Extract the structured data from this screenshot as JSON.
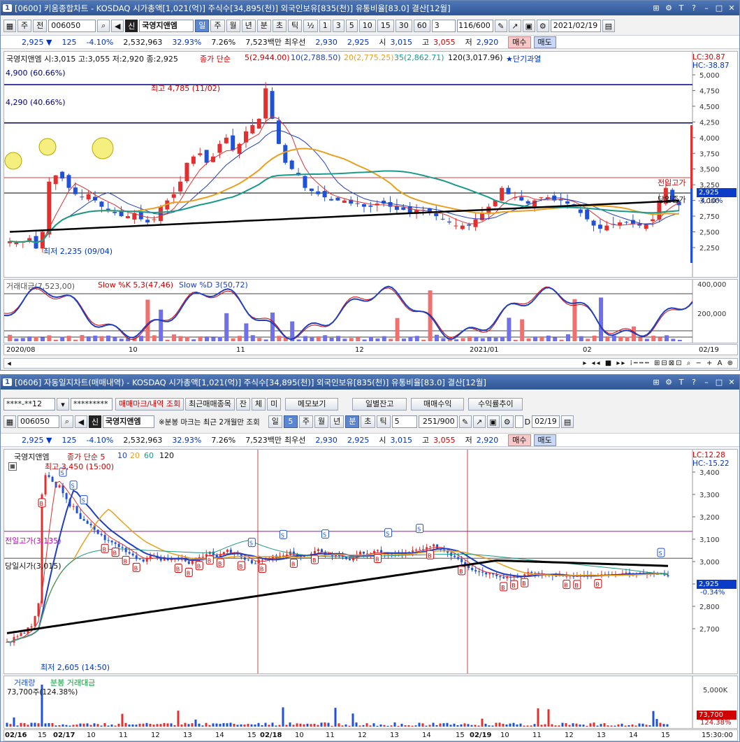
{
  "w1": {
    "title": "[0600] 키움종합차트 - KOSDAQ 시가총액[1,021(억)] 주식수[34,895(천)] 외국인보유[835(천)] 유통비율[83.0] 결산[12월]",
    "num": "1",
    "toolbar": {
      "mode": "주",
      "market": "전",
      "code": "006050",
      "stock": "국영지앤엠",
      "periods": [
        "일",
        "주",
        "월",
        "년",
        "분",
        "초",
        "틱"
      ],
      "half": "½",
      "nums": [
        "1",
        "3",
        "5",
        "10",
        "15",
        "30",
        "60"
      ],
      "sel": "3",
      "count": "116",
      "total": "/600",
      "date": "2021/02/19",
      "sin": "신"
    },
    "quote": {
      "price": "2,925 ▼",
      "chg": "125",
      "pct": "-4.10%",
      "vol": "2,532,963",
      "turn": "32.93%",
      "r2": "7.26%",
      "amt": "7,523백만",
      "bestlabel": "최우선",
      "b1": "2,930",
      "b2": "2,925",
      "open_l": "시",
      "open": "3,015",
      "high_l": "고",
      "high": "3,055",
      "low_l": "저",
      "low": "2,920",
      "buy": "매수",
      "sell": "매도"
    },
    "legend": {
      "ohlc": "국영지앤엠 시:3,015 고:3,055 저:2,920 종:2,925",
      "ma": "종가 단순",
      "ma5": "5(2,944.00)",
      "ma10": "10(2,788.50)",
      "ma20": "20(2,775.25)",
      "ma35": "35(2,862.71)",
      "ma120": "120(3,017.96)",
      "star": "★단기과열"
    },
    "lc": "LC:30.87",
    "hc": "HC:-38.87",
    "y": [
      "5,000",
      "4,750",
      "4,500",
      "4,250",
      "4,000",
      "3,750",
      "3,500",
      "3,250",
      "3,000",
      "2,750",
      "2,500",
      "2,250"
    ],
    "hl1": "4,900 (60.66%)",
    "hl2": "4,290 (40.66%)",
    "max": "최고 4,785 (11/02)",
    "min": "최저 2,235 (09/04)",
    "prevhi": "전일고가",
    "todayclose": "당일종가",
    "cur": "2,925",
    "curpct": "-4.10%",
    "sub": {
      "vol": "거래대금(7,523,00)",
      "k": "Slow %K 5,3(47,46)",
      "d": "Slow %D 3(50,72)",
      "y1": "400,000",
      "y2": "200,000"
    },
    "x": [
      "2020/08",
      "10",
      "11",
      "12",
      "2021/01",
      "02",
      "02/19"
    ]
  },
  "w2": {
    "title": "[0606] 자동일지차트(매매내역) - KOSDAQ 시가총액[1,021(억)] 주식수[34,895(천)] 외국인보유[835(천)] 유통비율[83.0] 결산[12월]",
    "num": "1",
    "acct": "****-**12",
    "pw": "*********",
    "btns": [
      "매매마크/내역 조회",
      "최근매매종목",
      "잔",
      "체",
      "미",
      "메모보기",
      "일별잔고",
      "매매수익",
      "수익률추이"
    ],
    "toolbar": {
      "code": "006050",
      "stock": "국영지앤엠",
      "note": "※분봉 마크는 최근 2개월만 조회",
      "periods": [
        "일",
        "주",
        "월",
        "년",
        "분",
        "초",
        "틱"
      ],
      "sel": "5",
      "count": "251",
      "total": "/900",
      "d": "D",
      "date": "02/19",
      "sin": "신"
    },
    "quote": {
      "price": "2,925 ▼",
      "chg": "125",
      "pct": "-4.10%",
      "vol": "2,532,963",
      "turn": "32.93%",
      "r2": "7.26%",
      "amt": "7,523백만",
      "bestlabel": "최우선",
      "b1": "2,930",
      "b2": "2,925",
      "open_l": "시",
      "open": "3,015",
      "high_l": "고",
      "high": "3,055",
      "low_l": "저",
      "low": "2,920",
      "buy": "매수",
      "sell": "매도"
    },
    "legend": {
      "stock": "국영지앤엠",
      "ma": "종가 단순 5",
      "m10": "10",
      "m20": "20",
      "m60": "60",
      "m120": "120"
    },
    "lc": "LC:12.28",
    "hc": "HC:-15.22",
    "y": [
      "3,400",
      "3,300",
      "3,200",
      "3,100",
      "3,000",
      "2,900",
      "2,800",
      "2,700"
    ],
    "max": "최고 3,450 (15:00)",
    "min": "최저 2,605 (14:50)",
    "prevhi": "전일고가(3,135)",
    "todayopen": "당일시가(3,015)",
    "cur": "2,925",
    "curpct": "-0.34%",
    "sub": {
      "vol": "거래량",
      "amt": "분봉 거래대금",
      "val": "73,700주(124.38%)",
      "y1": "5,000K",
      "cur": "73,700",
      "curpct": "124.38%"
    },
    "x": [
      "02/16",
      "15",
      "02/17",
      "10",
      "11",
      "12",
      "13",
      "14",
      "15",
      "02/18",
      "10",
      "11",
      "12",
      "13",
      "14",
      "15",
      "02/19",
      "10",
      "11",
      "12",
      "13",
      "14",
      "15"
    ],
    "time": "15:30:00"
  },
  "colors": {
    "up": "#e03030",
    "down": "#1f52d6",
    "ma5": "#e03030",
    "ma10": "#1f3fbf",
    "ma20": "#e8a020",
    "ma60": "#1a9a8a",
    "ma120": "#000000"
  }
}
